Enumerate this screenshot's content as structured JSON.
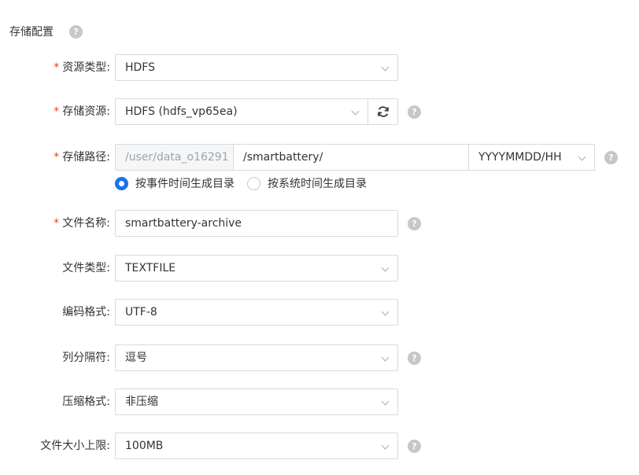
{
  "section": {
    "title": "存储配置"
  },
  "help_glyph": "?",
  "fields": {
    "resource_type": {
      "required": "*",
      "label": "资源类型:",
      "value": "HDFS"
    },
    "storage_resource": {
      "required": "*",
      "label": "存储资源:",
      "value": "HDFS (hdfs_vp65ea)"
    },
    "storage_path": {
      "required": "*",
      "label": "存储路径:",
      "prefix": "/user/data_o16291",
      "value": "/smartbattery/",
      "format": "YYYYMMDD/HH",
      "radio_options": [
        {
          "label": "按事件时间生成目录",
          "selected": true
        },
        {
          "label": "按系统时间生成目录",
          "selected": false
        }
      ]
    },
    "file_name": {
      "required": "*",
      "label": "文件名称:",
      "value": "smartbattery-archive"
    },
    "file_type": {
      "label": "文件类型:",
      "value": "TEXTFILE"
    },
    "encoding": {
      "label": "编码格式:",
      "value": "UTF-8"
    },
    "column_separator": {
      "label": "列分隔符:",
      "value": "逗号"
    },
    "compression": {
      "label": "压缩格式:",
      "value": "非压缩"
    },
    "file_size_limit": {
      "label": "文件大小上限:",
      "value": "100MB"
    }
  },
  "icons": {
    "refresh": "refresh-icon",
    "help": "help-icon",
    "chevron": "chevron-down-icon"
  },
  "colors": {
    "required": "#e8412c",
    "accent": "#1a74e8",
    "border": "#d9dadc",
    "disabled_bg": "#f5f6f7",
    "help_icon": "#c4c7cc"
  }
}
